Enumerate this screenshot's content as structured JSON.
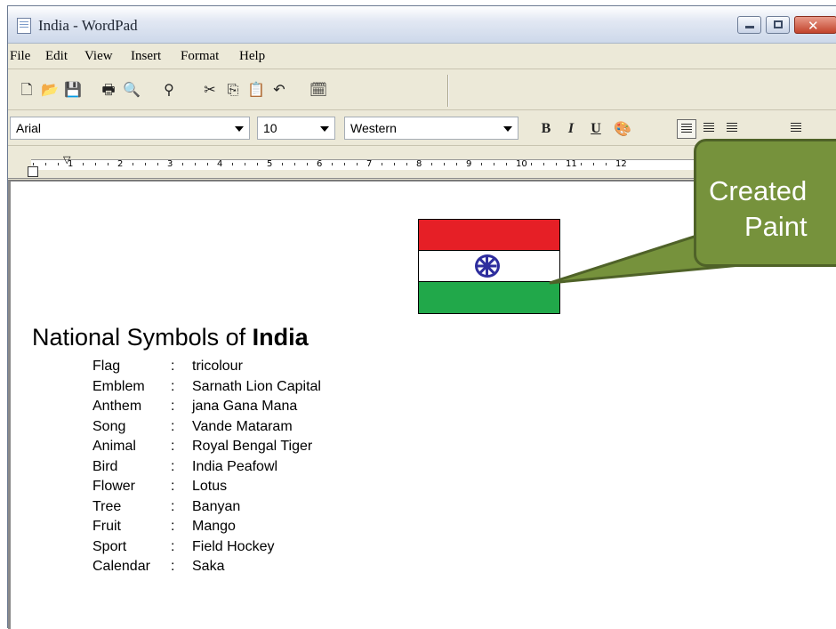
{
  "window": {
    "title": "India - WordPad",
    "controls": {
      "minimize": "–",
      "maximize": "□",
      "close": "✕"
    }
  },
  "menu": [
    "File",
    "Edit",
    "View",
    "Insert",
    "Format",
    "Help"
  ],
  "toolbar": {
    "icons": [
      "new-document",
      "open-folder",
      "save",
      "print",
      "print-preview",
      "find",
      "cut",
      "copy",
      "paste",
      "undo",
      "insert-date-time"
    ]
  },
  "format_bar": {
    "font": "Arial",
    "size": "10",
    "script": "Western",
    "bold": "B",
    "italic": "I",
    "underline": "U"
  },
  "ruler": {
    "numbers": [
      "1",
      "2",
      "3",
      "4",
      "5",
      "6",
      "7",
      "8",
      "9",
      "10",
      "11",
      "12"
    ]
  },
  "document": {
    "heading_prefix": "National Symbols of ",
    "heading_bold": "India",
    "symbols": [
      {
        "label": "Flag",
        "value": "tricolour"
      },
      {
        "label": "Emblem",
        "value": "Sarnath Lion Capital"
      },
      {
        "label": "Anthem",
        "value": "jana Gana Mana"
      },
      {
        "label": "Song",
        "value": "Vande Mataram"
      },
      {
        "label": "Animal",
        "value": "Royal Bengal Tiger"
      },
      {
        "label": "Bird",
        "value": "India Peafowl"
      },
      {
        "label": "Flower",
        "value": "Lotus"
      },
      {
        "label": "Tree",
        "value": "Banyan"
      },
      {
        "label": "Fruit",
        "value": "Mango"
      },
      {
        "label": "Sport",
        "value": "Field Hockey"
      },
      {
        "label": "Calendar",
        "value": "Saka"
      }
    ]
  },
  "callout": {
    "line1": "Created",
    "line2": "Paint",
    "color": "#76923c"
  }
}
